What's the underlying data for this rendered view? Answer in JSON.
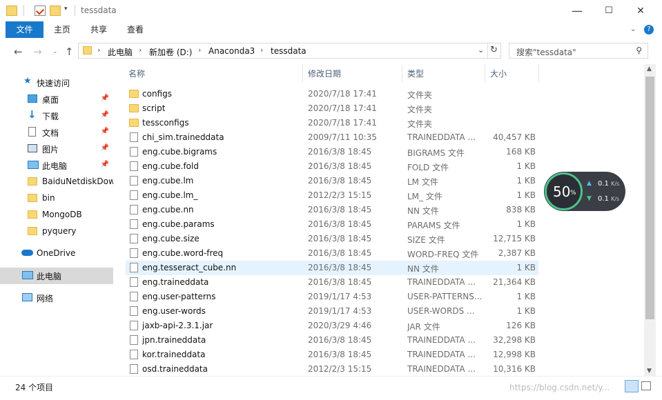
{
  "window": {
    "title": "tessdata",
    "minimize": "—",
    "maximize": "☐",
    "close": "✕"
  },
  "ribbon": {
    "tabs": [
      "文件",
      "主页",
      "共享",
      "查看"
    ]
  },
  "address": {
    "crumbs": [
      "此电脑",
      "新加卷 (D:)",
      "Anaconda3",
      "tessdata"
    ],
    "search_placeholder": "搜索\"tessdata\""
  },
  "sidebar": {
    "items": [
      {
        "label": "快速访问",
        "icon": "star-icon",
        "pinned": false
      },
      {
        "label": "桌面",
        "icon": "desktop-icon",
        "pinned": true
      },
      {
        "label": "下载",
        "icon": "download-icon",
        "pinned": true
      },
      {
        "label": "文档",
        "icon": "document-icon",
        "pinned": true
      },
      {
        "label": "图片",
        "icon": "picture-icon",
        "pinned": true
      },
      {
        "label": "此电脑",
        "icon": "computer-icon",
        "pinned": true
      },
      {
        "label": "BaiduNetdiskDownload",
        "icon": "folder-icon",
        "pinned": false
      },
      {
        "label": "bin",
        "icon": "folder-icon",
        "pinned": false
      },
      {
        "label": "MongoDB",
        "icon": "folder-icon",
        "pinned": false
      },
      {
        "label": "pyquery",
        "icon": "folder-icon",
        "pinned": false
      },
      {
        "label": "OneDrive",
        "icon": "cloud-icon",
        "pinned": false
      },
      {
        "label": "此电脑",
        "icon": "computer-icon",
        "pinned": false
      },
      {
        "label": "网络",
        "icon": "network-icon",
        "pinned": false
      }
    ]
  },
  "columns": {
    "name": "名称",
    "date": "修改日期",
    "type": "类型",
    "size": "大小"
  },
  "files": [
    {
      "name": "configs",
      "date": "2020/7/18 17:41",
      "type": "文件夹",
      "size": "",
      "kind": "folder"
    },
    {
      "name": "script",
      "date": "2020/7/18 17:41",
      "type": "文件夹",
      "size": "",
      "kind": "folder"
    },
    {
      "name": "tessconfigs",
      "date": "2020/7/18 17:41",
      "type": "文件夹",
      "size": "",
      "kind": "folder"
    },
    {
      "name": "chi_sim.traineddata",
      "date": "2009/7/11 10:35",
      "type": "TRAINEDDATA ...",
      "size": "40,457 KB",
      "kind": "file"
    },
    {
      "name": "eng.cube.bigrams",
      "date": "2016/3/8 18:45",
      "type": "BIGRAMS 文件",
      "size": "168 KB",
      "kind": "file"
    },
    {
      "name": "eng.cube.fold",
      "date": "2016/3/8 18:45",
      "type": "FOLD 文件",
      "size": "1 KB",
      "kind": "file"
    },
    {
      "name": "eng.cube.lm",
      "date": "2016/3/8 18:45",
      "type": "LM 文件",
      "size": "1 KB",
      "kind": "file"
    },
    {
      "name": "eng.cube.lm_",
      "date": "2012/2/3 15:15",
      "type": "LM_ 文件",
      "size": "1 KB",
      "kind": "file"
    },
    {
      "name": "eng.cube.nn",
      "date": "2016/3/8 18:45",
      "type": "NN 文件",
      "size": "838 KB",
      "kind": "file"
    },
    {
      "name": "eng.cube.params",
      "date": "2016/3/8 18:45",
      "type": "PARAMS 文件",
      "size": "1 KB",
      "kind": "file"
    },
    {
      "name": "eng.cube.size",
      "date": "2016/3/8 18:45",
      "type": "SIZE 文件",
      "size": "12,715 KB",
      "kind": "file"
    },
    {
      "name": "eng.cube.word-freq",
      "date": "2016/3/8 18:45",
      "type": "WORD-FREQ 文件",
      "size": "2,387 KB",
      "kind": "file"
    },
    {
      "name": "eng.tesseract_cube.nn",
      "date": "2016/3/8 18:45",
      "type": "NN 文件",
      "size": "1 KB",
      "kind": "file",
      "selected": true
    },
    {
      "name": "eng.traineddata",
      "date": "2016/3/8 18:45",
      "type": "TRAINEDDATA ...",
      "size": "21,364 KB",
      "kind": "file"
    },
    {
      "name": "eng.user-patterns",
      "date": "2019/1/17 4:53",
      "type": "USER-PATTERNS...",
      "size": "1 KB",
      "kind": "file"
    },
    {
      "name": "eng.user-words",
      "date": "2019/1/17 4:53",
      "type": "USER-WORDS ...",
      "size": "1 KB",
      "kind": "file"
    },
    {
      "name": "jaxb-api-2.3.1.jar",
      "date": "2020/3/29 4:46",
      "type": "JAR 文件",
      "size": "126 KB",
      "kind": "file"
    },
    {
      "name": "jpn.traineddata",
      "date": "2016/3/8 18:45",
      "type": "TRAINEDDATA ...",
      "size": "32,298 KB",
      "kind": "file"
    },
    {
      "name": "kor.traineddata",
      "date": "2016/3/8 18:45",
      "type": "TRAINEDDATA ...",
      "size": "12,998 KB",
      "kind": "file"
    },
    {
      "name": "osd.traineddata",
      "date": "2012/2/3 15:15",
      "type": "TRAINEDDATA ...",
      "size": "10,316 KB",
      "kind": "file"
    }
  ],
  "status": {
    "count": "24 个项目",
    "watermark": "https://blog.csdn.net/y..."
  },
  "widget": {
    "percent": "50",
    "percent_sign": "%",
    "upload": "0.1",
    "download": "0.1",
    "unit": "K/s"
  },
  "colors": {
    "accent": "#1979ca",
    "selected_row": "#e5f3ff",
    "folder": "#f8d775"
  }
}
